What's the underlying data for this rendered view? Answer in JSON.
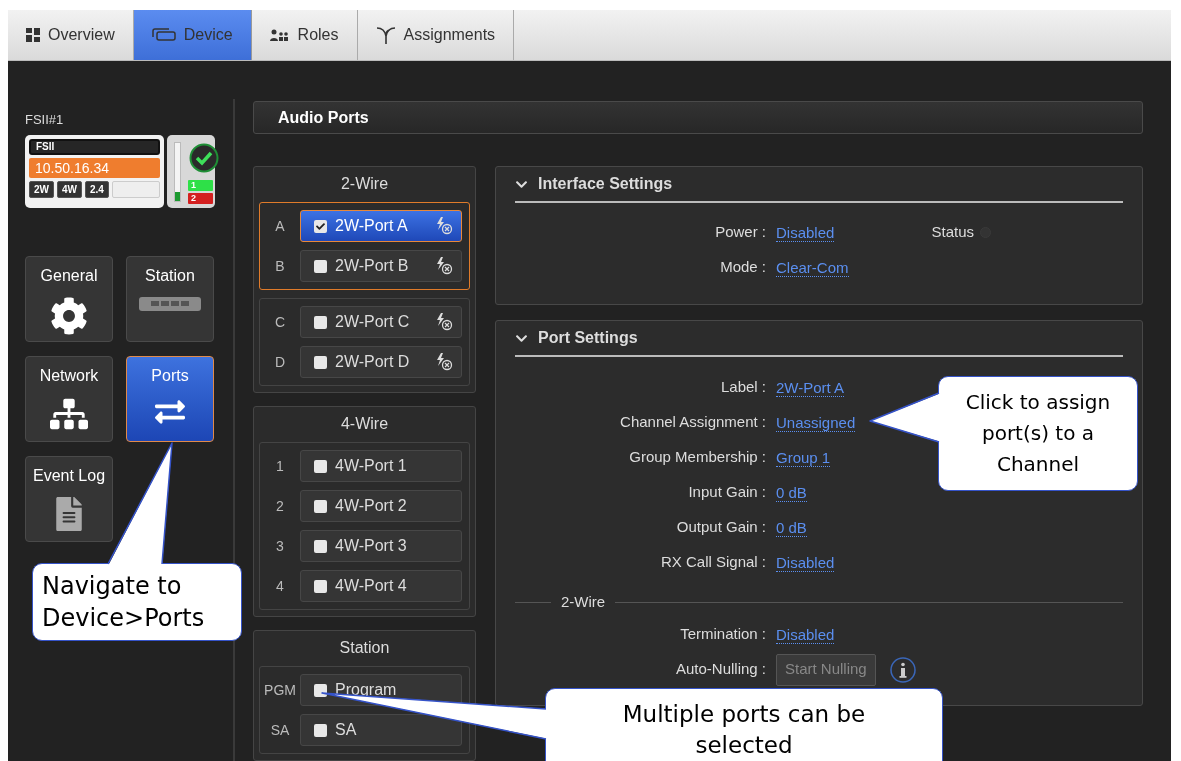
{
  "tabs": [
    {
      "label": "Overview",
      "selected": false
    },
    {
      "label": "Device",
      "selected": true
    },
    {
      "label": "Roles",
      "selected": false
    },
    {
      "label": "Assignments",
      "selected": false
    }
  ],
  "device": {
    "title": "FSII#1",
    "model": "FSII",
    "ip": "10.50.16.34",
    "badges": [
      "2W",
      "4W",
      "2.4"
    ],
    "meter": {
      "level": 0.15
    },
    "online": true,
    "plugs": [
      {
        "label": "1",
        "color": "#2ee048"
      },
      {
        "label": "2",
        "color": "#d42020"
      }
    ]
  },
  "nav": [
    {
      "label": "General",
      "selected": false
    },
    {
      "label": "Station",
      "selected": false
    },
    {
      "label": "Network",
      "selected": false
    },
    {
      "label": "Ports",
      "selected": true
    },
    {
      "label": "Event Log",
      "selected": false
    }
  ],
  "header": {
    "title": "Audio Ports"
  },
  "port_groups": [
    {
      "title": "2-Wire",
      "kind": "two-wire",
      "subgroups": [
        {
          "selected": true,
          "ports": [
            {
              "slot": "A",
              "label": "2W-Port A",
              "checked": true,
              "selected": true
            },
            {
              "slot": "B",
              "label": "2W-Port B",
              "checked": false,
              "selected": false
            }
          ]
        },
        {
          "selected": false,
          "ports": [
            {
              "slot": "C",
              "label": "2W-Port C",
              "checked": false,
              "selected": false
            },
            {
              "slot": "D",
              "label": "2W-Port D",
              "checked": false,
              "selected": false
            }
          ]
        }
      ]
    },
    {
      "title": "4-Wire",
      "kind": "four-wire",
      "subgroups": [
        {
          "selected": false,
          "ports": [
            {
              "slot": "1",
              "label": "4W-Port 1",
              "checked": false,
              "selected": false
            },
            {
              "slot": "2",
              "label": "4W-Port 2",
              "checked": false,
              "selected": false
            },
            {
              "slot": "3",
              "label": "4W-Port 3",
              "checked": false,
              "selected": false
            },
            {
              "slot": "4",
              "label": "4W-Port 4",
              "checked": false,
              "selected": false
            }
          ]
        }
      ]
    },
    {
      "title": "Station",
      "kind": "station",
      "subgroups": [
        {
          "selected": false,
          "ports": [
            {
              "slot": "PGM",
              "label": "Program",
              "checked": false,
              "selected": false
            },
            {
              "slot": "SA",
              "label": "SA",
              "checked": false,
              "selected": false
            }
          ]
        }
      ]
    }
  ],
  "interface_settings": {
    "title": "Interface Settings",
    "expanded": true,
    "rows": [
      {
        "kind": "link",
        "label": "Power :",
        "value": "Disabled"
      },
      {
        "kind": "link",
        "label": "Mode :",
        "value": "Clear-Com"
      }
    ],
    "status": {
      "label": "Status"
    }
  },
  "port_settings": {
    "title": "Port Settings",
    "expanded": true,
    "rows": [
      {
        "kind": "link",
        "label": "Label :",
        "value": "2W-Port A"
      },
      {
        "kind": "link",
        "label": "Channel Assignment :",
        "value": "Unassigned"
      },
      {
        "kind": "link",
        "label": "Group Membership :",
        "value": "Group 1"
      },
      {
        "kind": "link",
        "label": "Input Gain :",
        "value": "0 dB"
      },
      {
        "kind": "link",
        "label": "Output Gain :",
        "value": "0 dB"
      },
      {
        "kind": "link",
        "label": "RX Call Signal :",
        "value": "Disabled"
      }
    ],
    "section": {
      "title": "2-Wire",
      "rows": [
        {
          "kind": "link",
          "label": "Termination :",
          "value": "Disabled"
        },
        {
          "kind": "button",
          "label": "Auto-Nulling :",
          "value": "Start Nulling",
          "disabled": true
        }
      ]
    }
  },
  "callouts": [
    {
      "text": "Navigate to Device>Ports"
    },
    {
      "text": "Click to assign port(s) to a Channel"
    },
    {
      "text": "Multiple ports can be selected"
    }
  ]
}
